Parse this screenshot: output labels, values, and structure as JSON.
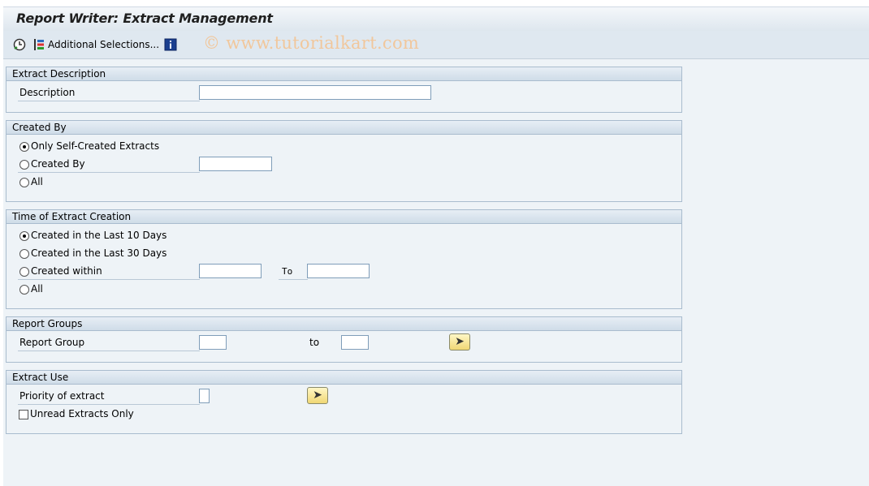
{
  "window": {
    "title": "Report Writer: Extract Management"
  },
  "toolbar": {
    "additional_selections_label": "Additional Selections...",
    "watermark": "© www.tutorialkart.com"
  },
  "extract_description": {
    "header": "Extract Description",
    "description_label": "Description",
    "description_value": ""
  },
  "created_by": {
    "header": "Created By",
    "options": [
      "Only Self-Created Extracts",
      "Created By",
      "All"
    ],
    "selected": "Only Self-Created Extracts",
    "created_by_value": ""
  },
  "time_of_creation": {
    "header": "Time of Extract Creation",
    "options": [
      "Created in the Last 10 Days",
      "Created in the Last 30 Days",
      "Created within",
      "All"
    ],
    "selected": "Created in the Last 10 Days",
    "to_label": "To",
    "from_value": "",
    "to_value": ""
  },
  "report_groups": {
    "header": "Report Groups",
    "report_group_label": "Report Group",
    "to_label": "to",
    "from_value": "",
    "to_value": ""
  },
  "extract_use": {
    "header": "Extract Use",
    "priority_label": "Priority of extract",
    "priority_value": "",
    "unread_label": "Unread Extracts Only",
    "unread_checked": false
  },
  "colors": {
    "panel_bg": "#eef3f7",
    "group_border": "#a9bcce",
    "watermark": "#f1c79c"
  }
}
